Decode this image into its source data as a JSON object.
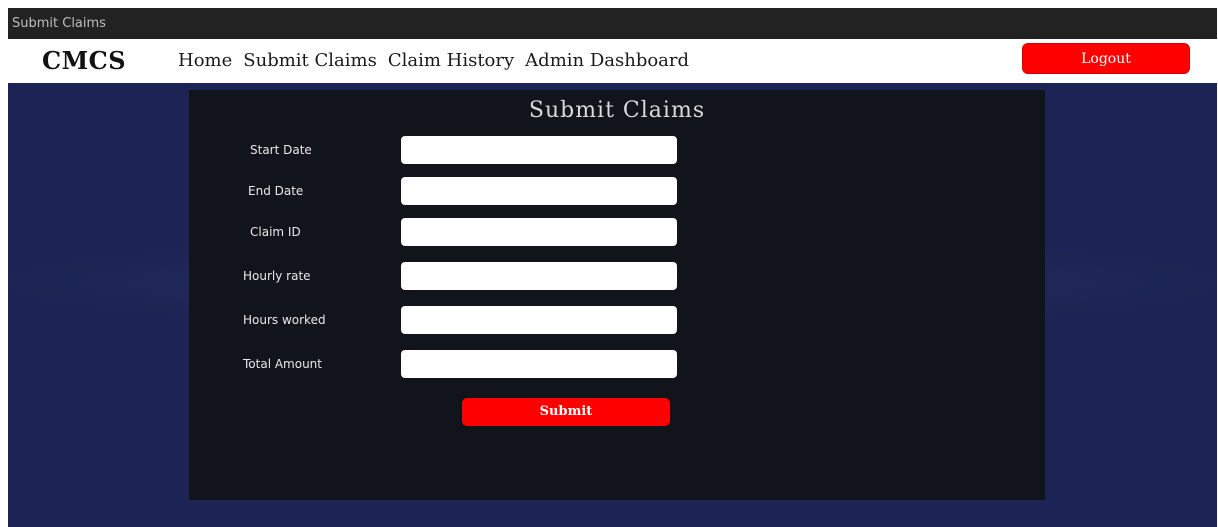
{
  "window": {
    "title": "Submit Claims"
  },
  "navbar": {
    "brand": "CMCS",
    "links": [
      {
        "label": "Home"
      },
      {
        "label": "Submit Claims"
      },
      {
        "label": "Claim History"
      },
      {
        "label": "Admin Dashboard"
      }
    ],
    "logout_label": "Logout"
  },
  "form": {
    "title": "Submit Claims",
    "fields": [
      {
        "label": "Start Date",
        "value": ""
      },
      {
        "label": "End Date",
        "value": ""
      },
      {
        "label": "Claim ID",
        "value": ""
      },
      {
        "label": "Hourly rate",
        "value": ""
      },
      {
        "label": "Hours worked",
        "value": ""
      },
      {
        "label": "Total Amount",
        "value": ""
      }
    ],
    "submit_label": "Submit"
  },
  "colors": {
    "page_background": "#1b2454",
    "panel_background": "#12141c",
    "accent": "#ff0000",
    "navbar_background": "#ffffff"
  }
}
